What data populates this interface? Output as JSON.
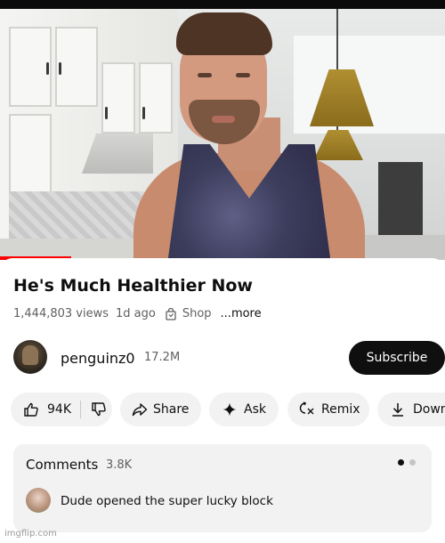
{
  "video": {
    "progress_fraction": 0.16,
    "accent_color": "#ff0000"
  },
  "title": "He's Much Healthier Now",
  "meta": {
    "views": "1,444,803 views",
    "age": "1d ago",
    "shop_icon": "shopping-bag-icon",
    "shop_label": "Shop",
    "more_label": "...more"
  },
  "channel": {
    "name": "penguinz0",
    "subscribers": "17.2M",
    "subscribe_label": "Subscribe"
  },
  "actions": {
    "like_icon": "thumbs-up-icon",
    "like_count": "94K",
    "dislike_icon": "thumbs-down-icon",
    "share_icon": "share-arrow-icon",
    "share_label": "Share",
    "ask_icon": "sparkle-icon",
    "ask_label": "Ask",
    "remix_icon": "remix-icon",
    "remix_label": "Remix",
    "download_icon": "download-icon",
    "download_label": "Download"
  },
  "comments": {
    "title": "Comments",
    "count": "3.8K",
    "top_comment": "Dude opened the super lucky block",
    "carousel_pages": 2,
    "carousel_active": 0
  },
  "watermark": "imgflip.com",
  "colors": {
    "button_dark": "#0f0f0f",
    "chip_bg": "#f2f2f2",
    "secondary_text": "#606060"
  }
}
